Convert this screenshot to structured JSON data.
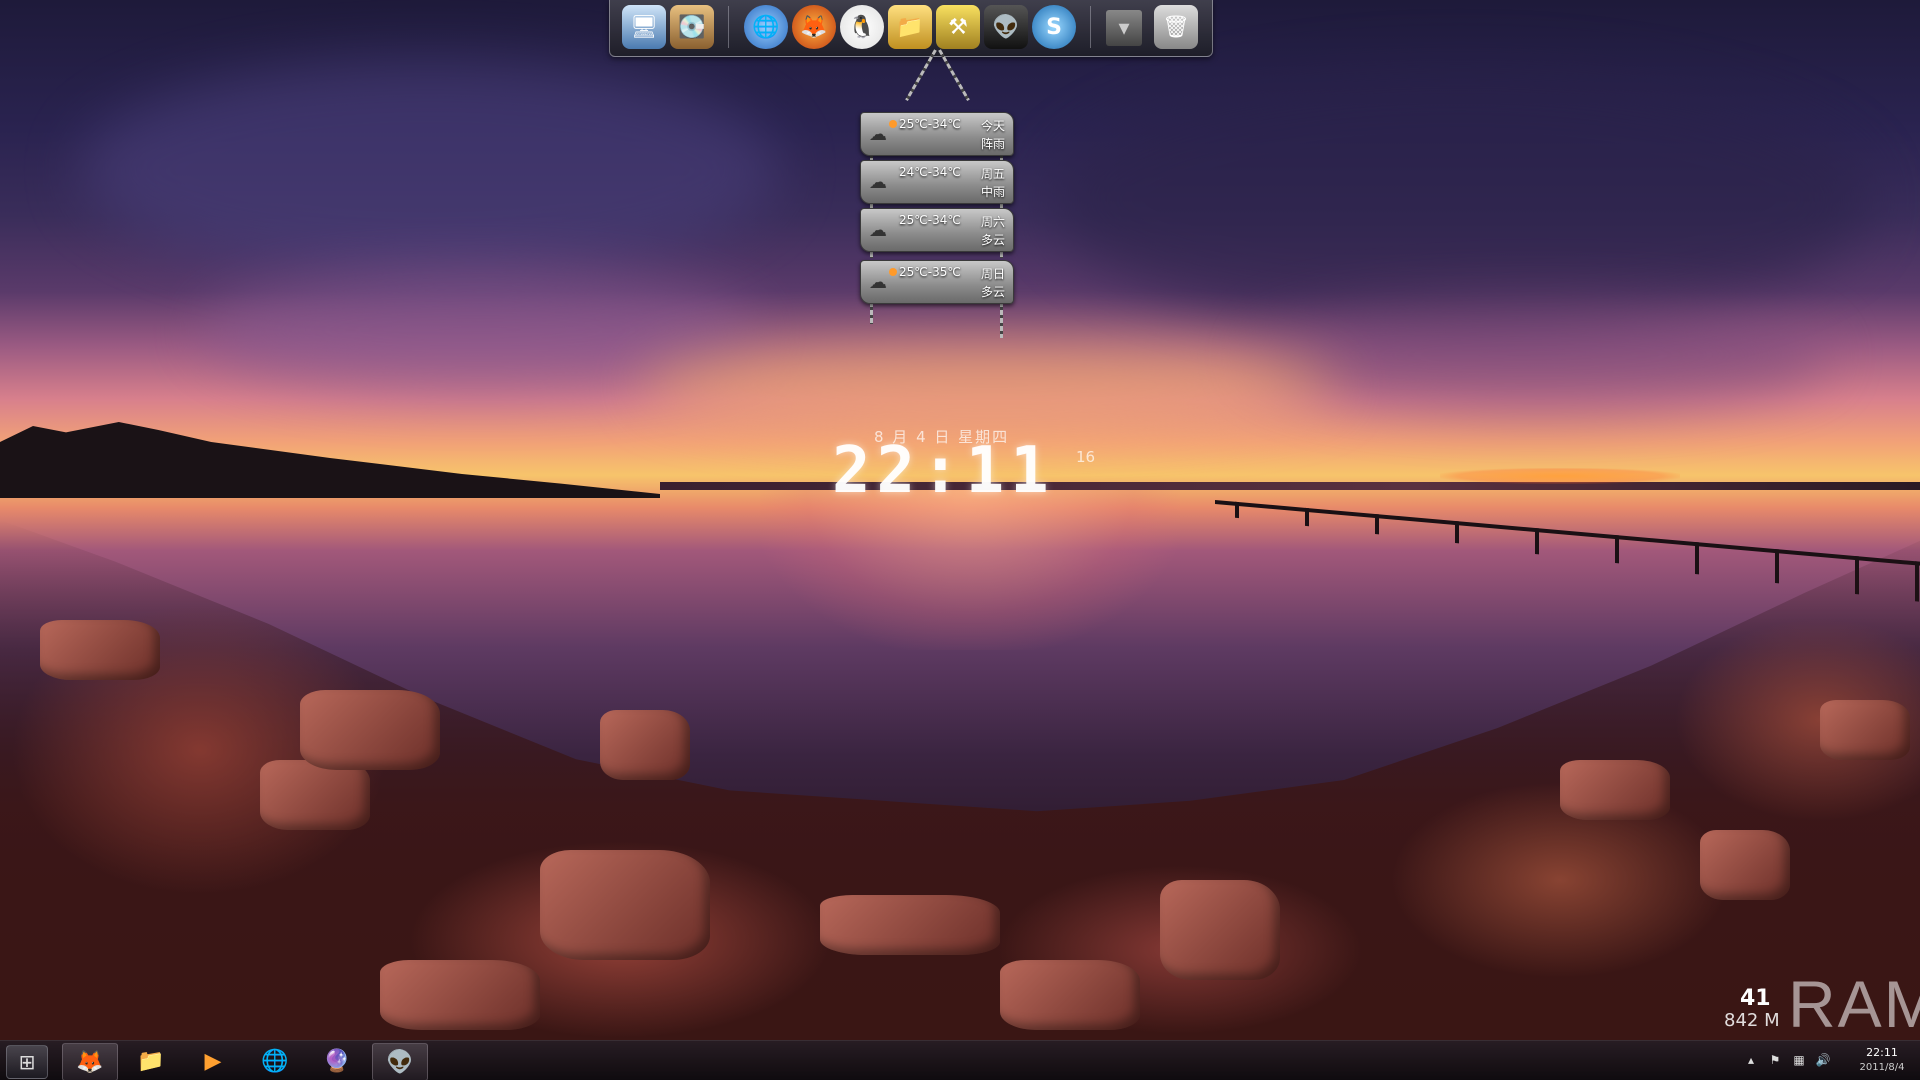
{
  "dock": {
    "icons": [
      {
        "name": "computer-icon",
        "glyph": "🖥"
      },
      {
        "name": "hard-disk-icon",
        "glyph": "💽"
      },
      {
        "name": "ie-browser-icon",
        "glyph": "🌐"
      },
      {
        "name": "firefox-icon",
        "glyph": "🦊"
      },
      {
        "name": "qq-icon",
        "glyph": "🐧"
      },
      {
        "name": "download-folder-icon",
        "glyph": "📁"
      },
      {
        "name": "tools-icon",
        "glyph": "⚒"
      },
      {
        "name": "foobar-icon",
        "glyph": "👽"
      },
      {
        "name": "skype-icon",
        "glyph": "S"
      },
      {
        "name": "expand-arrow-icon",
        "glyph": "▾"
      },
      {
        "name": "recycle-bin-icon",
        "glyph": "🗑"
      }
    ]
  },
  "weather": {
    "days": [
      {
        "temp": "25℃-34℃",
        "day": "今天",
        "condition": "阵雨"
      },
      {
        "temp": "24℃-34℃",
        "day": "周五",
        "condition": "中雨"
      },
      {
        "temp": "25℃-34℃",
        "day": "周六",
        "condition": "多云"
      },
      {
        "temp": "25℃-35℃",
        "day": "周日",
        "condition": "多云"
      }
    ]
  },
  "clock": {
    "date": "8 月 4 日  星期四",
    "time": "22:11",
    "seconds": "16"
  },
  "ram": {
    "label": "RAM",
    "percent": "41",
    "used": "842 M"
  },
  "taskbar": {
    "start_glyph": "⊞",
    "items": [
      {
        "name": "taskbar-firefox",
        "glyph": "🦊",
        "active": true
      },
      {
        "name": "taskbar-explorer",
        "glyph": "📁",
        "active": false
      },
      {
        "name": "taskbar-media-player",
        "glyph": "▶",
        "active": false
      },
      {
        "name": "taskbar-ie-browser",
        "glyph": "🌐",
        "active": false
      },
      {
        "name": "taskbar-messenger",
        "glyph": "🔮",
        "active": false
      },
      {
        "name": "taskbar-foobar",
        "glyph": "👽",
        "active": true
      }
    ],
    "tray": {
      "time": "22:11",
      "date": "2011/8/4",
      "icons": [
        {
          "name": "tray-show-hidden-icon",
          "glyph": "▴"
        },
        {
          "name": "tray-action-center-icon",
          "glyph": "⚑"
        },
        {
          "name": "tray-network-icon",
          "glyph": "▦"
        },
        {
          "name": "tray-volume-icon",
          "glyph": "🔊"
        }
      ]
    }
  },
  "colors": {
    "accent_sun": "#ff9a2a",
    "taskbar_bg": "#140e14"
  }
}
